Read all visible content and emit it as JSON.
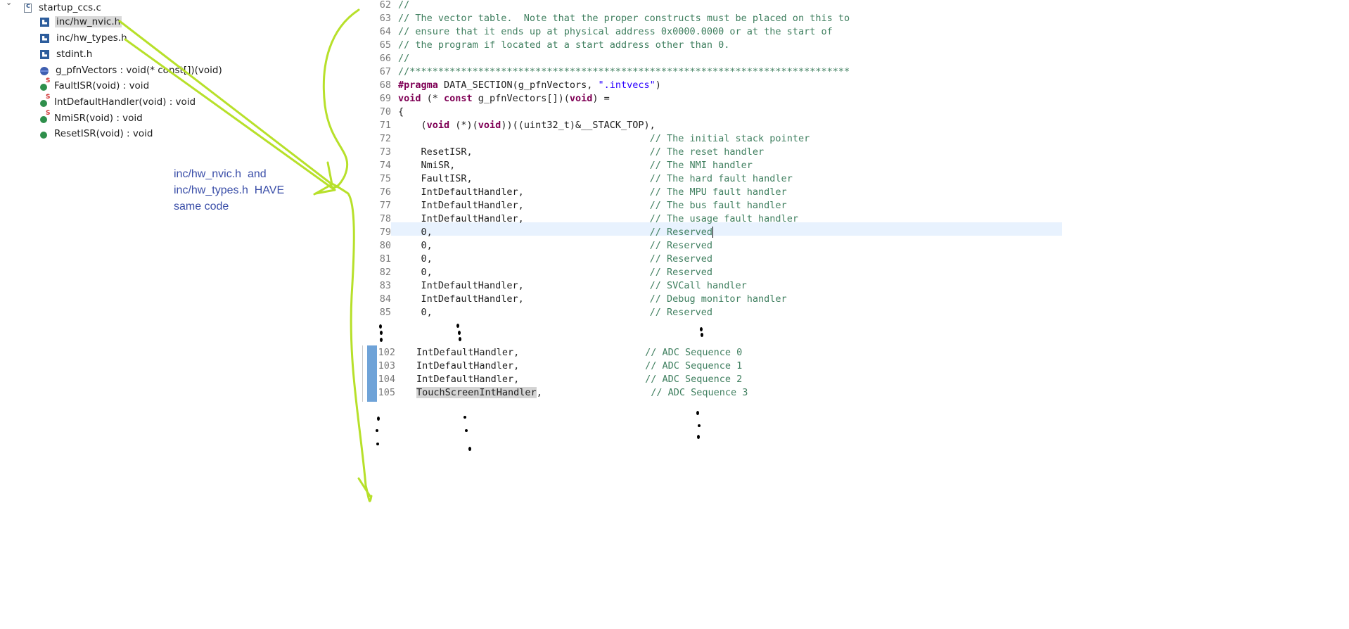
{
  "outline": {
    "items": [
      {
        "label": "startup_ccs.c",
        "icon": "c-file-icon",
        "kind": "file"
      },
      {
        "label": "inc/hw_nvic.h",
        "icon": "include-icon",
        "kind": "include",
        "selected": true
      },
      {
        "label": "inc/hw_types.h",
        "icon": "include-icon",
        "kind": "include"
      },
      {
        "label": "stdint.h",
        "icon": "include-icon",
        "kind": "include"
      },
      {
        "label": "g_pfnVectors : void(* const[])(void)",
        "icon": "variable-icon",
        "kind": "var"
      },
      {
        "label": "FaultISR(void) : void",
        "icon": "static-function-icon",
        "kind": "fn-static"
      },
      {
        "label": "IntDefaultHandler(void) : void",
        "icon": "static-function-icon",
        "kind": "fn-static"
      },
      {
        "label": "NmiSR(void) : void",
        "icon": "static-function-icon",
        "kind": "fn-static"
      },
      {
        "label": "ResetISR(void) : void",
        "icon": "function-icon",
        "kind": "fn"
      }
    ]
  },
  "annotation": {
    "lines": [
      "inc/hw_nvic.h  and",
      "inc/hw_types.h  HAVE",
      "same code"
    ]
  },
  "editor": {
    "lines": [
      {
        "n": "62",
        "parts": [
          {
            "t": "//",
            "c": "cmt"
          }
        ]
      },
      {
        "n": "63",
        "parts": [
          {
            "t": "// The vector table.  Note that the proper constructs must be placed on this to",
            "c": "cmt"
          }
        ]
      },
      {
        "n": "64",
        "parts": [
          {
            "t": "// ensure that it ends up at physical address 0x0000.0000 or at the start of",
            "c": "cmt"
          }
        ]
      },
      {
        "n": "65",
        "parts": [
          {
            "t": "// the program if located at a start address other than 0.",
            "c": "cmt"
          }
        ]
      },
      {
        "n": "66",
        "parts": [
          {
            "t": "//",
            "c": "cmt"
          }
        ]
      },
      {
        "n": "67",
        "parts": [
          {
            "t": "//*****************************************************************************",
            "c": "cmt"
          }
        ]
      },
      {
        "n": "68",
        "parts": [
          {
            "t": "#pragma",
            "c": "kw"
          },
          {
            "t": " DATA_SECTION(g_pfnVectors, ",
            "c": ""
          },
          {
            "t": "\".intvecs\"",
            "c": "str"
          },
          {
            "t": ")",
            "c": ""
          }
        ]
      },
      {
        "n": "69",
        "parts": [
          {
            "t": "void",
            "c": "kw"
          },
          {
            "t": " (* ",
            "c": ""
          },
          {
            "t": "const",
            "c": "kw"
          },
          {
            "t": " g_pfnVectors[])(",
            "c": ""
          },
          {
            "t": "void",
            "c": "kw"
          },
          {
            "t": ") =",
            "c": ""
          }
        ]
      },
      {
        "n": "70",
        "parts": [
          {
            "t": "{",
            "c": ""
          }
        ]
      },
      {
        "n": "71",
        "parts": [
          {
            "t": "    (",
            "c": ""
          },
          {
            "t": "void",
            "c": "kw"
          },
          {
            "t": " (*)(",
            "c": ""
          },
          {
            "t": "void",
            "c": "kw"
          },
          {
            "t": "))((uint32_t)&__STACK_TOP),",
            "c": ""
          }
        ]
      },
      {
        "n": "72",
        "parts": [
          {
            "t": "                                            ",
            "c": ""
          },
          {
            "t": "// The initial stack pointer",
            "c": "cmt"
          }
        ]
      },
      {
        "n": "73",
        "parts": [
          {
            "t": "    ResetISR,                               ",
            "c": ""
          },
          {
            "t": "// The reset handler",
            "c": "cmt"
          }
        ]
      },
      {
        "n": "74",
        "parts": [
          {
            "t": "    NmiSR,                                  ",
            "c": ""
          },
          {
            "t": "// The NMI handler",
            "c": "cmt"
          }
        ]
      },
      {
        "n": "75",
        "parts": [
          {
            "t": "    FaultISR,                               ",
            "c": ""
          },
          {
            "t": "// The hard fault handler",
            "c": "cmt"
          }
        ]
      },
      {
        "n": "76",
        "parts": [
          {
            "t": "    IntDefaultHandler,                      ",
            "c": ""
          },
          {
            "t": "// The MPU fault handler",
            "c": "cmt"
          }
        ]
      },
      {
        "n": "77",
        "parts": [
          {
            "t": "    IntDefaultHandler,                      ",
            "c": ""
          },
          {
            "t": "// The bus fault handler",
            "c": "cmt"
          }
        ]
      },
      {
        "n": "78",
        "parts": [
          {
            "t": "    IntDefaultHandler,                      ",
            "c": ""
          },
          {
            "t": "// The usage fault handler",
            "c": "cmt"
          }
        ]
      },
      {
        "n": "79",
        "parts": [
          {
            "t": "    0,                                      ",
            "c": ""
          },
          {
            "t": "// Reserved",
            "c": "cmt"
          }
        ],
        "current": true
      },
      {
        "n": "80",
        "parts": [
          {
            "t": "    0,                                      ",
            "c": ""
          },
          {
            "t": "// Reserved",
            "c": "cmt"
          }
        ]
      },
      {
        "n": "81",
        "parts": [
          {
            "t": "    0,                                      ",
            "c": ""
          },
          {
            "t": "// Reserved",
            "c": "cmt"
          }
        ]
      },
      {
        "n": "82",
        "parts": [
          {
            "t": "    0,                                      ",
            "c": ""
          },
          {
            "t": "// Reserved",
            "c": "cmt"
          }
        ]
      },
      {
        "n": "83",
        "parts": [
          {
            "t": "    IntDefaultHandler,                      ",
            "c": ""
          },
          {
            "t": "// SVCall handler",
            "c": "cmt"
          }
        ]
      },
      {
        "n": "84",
        "parts": [
          {
            "t": "    IntDefaultHandler,                      ",
            "c": ""
          },
          {
            "t": "// Debug monitor handler",
            "c": "cmt"
          }
        ]
      },
      {
        "n": "85",
        "parts": [
          {
            "t": "    0,                                      ",
            "c": ""
          },
          {
            "t": "// Reserved",
            "c": "cmt"
          }
        ]
      }
    ]
  },
  "editor2": {
    "lines": [
      {
        "n": "102",
        "parts": [
          {
            "t": "IntDefaultHandler,",
            "c": ""
          },
          {
            "t": "                      ",
            "c": ""
          },
          {
            "t": "// ADC Sequence 0",
            "c": "cmt"
          }
        ]
      },
      {
        "n": "103",
        "parts": [
          {
            "t": "IntDefaultHandler,",
            "c": ""
          },
          {
            "t": "                      ",
            "c": ""
          },
          {
            "t": "// ADC Sequence 1",
            "c": "cmt"
          }
        ]
      },
      {
        "n": "104",
        "parts": [
          {
            "t": "IntDefaultHandler,",
            "c": ""
          },
          {
            "t": "                      ",
            "c": ""
          },
          {
            "t": "// ADC Sequence 2",
            "c": "cmt"
          }
        ]
      },
      {
        "n": "105",
        "parts": [
          {
            "t": "TouchScreenIntHandler",
            "c": "hl"
          },
          {
            "t": ",",
            "c": ""
          },
          {
            "t": "                   ",
            "c": ""
          },
          {
            "t": "// ADC Sequence 3",
            "c": "cmt"
          }
        ]
      }
    ]
  },
  "colors": {
    "arrow": "#b7e02a",
    "annotation": "#3a4ea8",
    "comment": "#3f7f5f",
    "keyword": "#7f0055",
    "string": "#2a00ff",
    "current_line": "#e8f2fe",
    "gutter_marker": "#6fa3d8"
  }
}
